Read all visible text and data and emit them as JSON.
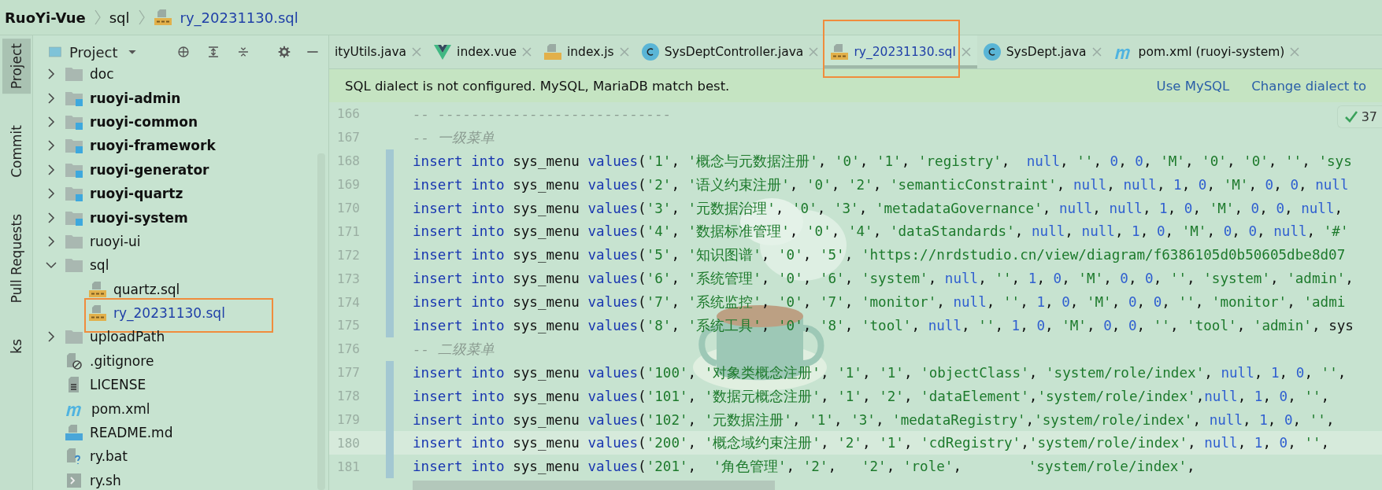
{
  "breadcrumb": [
    {
      "label": "RuoYi-Vue",
      "kind": "project"
    },
    {
      "label": "sql",
      "kind": "folder"
    },
    {
      "label": "ry_20231130.sql",
      "kind": "sql"
    }
  ],
  "tool_stripe": [
    {
      "label": "Project",
      "selected": true
    },
    {
      "label": "Commit",
      "selected": false
    },
    {
      "label": "Pull Requests",
      "selected": false
    },
    {
      "label": "ks",
      "selected": false
    }
  ],
  "project_panel": {
    "title": "Project",
    "tree": [
      {
        "label": "doc",
        "kind": "folder",
        "expanded": false
      },
      {
        "label": "ruoyi-admin",
        "kind": "module",
        "expanded": false
      },
      {
        "label": "ruoyi-common",
        "kind": "module",
        "expanded": false
      },
      {
        "label": "ruoyi-framework",
        "kind": "module",
        "expanded": false
      },
      {
        "label": "ruoyi-generator",
        "kind": "module",
        "expanded": false
      },
      {
        "label": "ruoyi-quartz",
        "kind": "module",
        "expanded": false
      },
      {
        "label": "ruoyi-system",
        "kind": "module",
        "expanded": false
      },
      {
        "label": "ruoyi-ui",
        "kind": "folder",
        "expanded": false
      },
      {
        "label": "sql",
        "kind": "folder",
        "expanded": true,
        "children": [
          {
            "label": "quartz.sql",
            "kind": "sql",
            "modified": false,
            "highlighted": false
          },
          {
            "label": "ry_20231130.sql",
            "kind": "sql",
            "modified": true,
            "highlighted": true
          }
        ]
      },
      {
        "label": "uploadPath",
        "kind": "folder",
        "expanded": false
      },
      {
        "label": ".gitignore",
        "kind": "ignore"
      },
      {
        "label": "LICENSE",
        "kind": "text"
      },
      {
        "label": "pom.xml",
        "kind": "maven"
      },
      {
        "label": "README.md",
        "kind": "markdown"
      },
      {
        "label": "ry.bat",
        "kind": "unknown"
      },
      {
        "label": "ry.sh",
        "kind": "shell"
      }
    ]
  },
  "tabs": [
    {
      "label": "ityUtils.java",
      "kind": "none",
      "selected": false,
      "modified": false,
      "highlighted": false
    },
    {
      "label": "index.vue",
      "kind": "vue",
      "selected": false,
      "modified": false,
      "highlighted": false
    },
    {
      "label": "index.js",
      "kind": "js",
      "selected": false,
      "modified": false,
      "highlighted": false
    },
    {
      "label": "SysDeptController.java",
      "kind": "class",
      "selected": false,
      "modified": false,
      "highlighted": false
    },
    {
      "label": "ry_20231130.sql",
      "kind": "sql",
      "selected": true,
      "modified": true,
      "highlighted": true
    },
    {
      "label": "SysDept.java",
      "kind": "class",
      "selected": false,
      "modified": false,
      "highlighted": false
    },
    {
      "label": "pom.xml (ruoyi-system)",
      "kind": "maven",
      "selected": false,
      "modified": false,
      "highlighted": false
    }
  ],
  "banner": {
    "message": "SQL dialect is not configured. MySQL, MariaDB match best.",
    "actions": [
      "Use MySQL",
      "Change dialect to"
    ]
  },
  "inspection_badge": "37",
  "code_lines": [
    {
      "number": "166",
      "text": "-- ----------------------------",
      "changed": false,
      "current": false
    },
    {
      "number": "167",
      "text": "-- 一级菜单",
      "changed": false,
      "current": false
    },
    {
      "number": "168",
      "text": "insert into sys_menu values('1', '概念与元数据注册', '0', '1', 'registry',  null, '', 0, 0, 'M', '0', '0', '', 'sys",
      "changed": true,
      "current": false
    },
    {
      "number": "169",
      "text": "insert into sys_menu values('2', '语义约束注册', '0', '2', 'semanticConstraint', null, null, 1, 0, 'M', 0, 0, null",
      "changed": true,
      "current": false
    },
    {
      "number": "170",
      "text": "insert into sys_menu values('3', '元数据治理', '0', '3', 'metadataGovernance', null, null, 1, 0, 'M', 0, 0, null,",
      "changed": true,
      "current": false
    },
    {
      "number": "171",
      "text": "insert into sys_menu values('4', '数据标准管理', '0', '4', 'dataStandards', null, null, 1, 0, 'M', 0, 0, null, '#'",
      "changed": true,
      "current": false
    },
    {
      "number": "172",
      "text": "insert into sys_menu values('5', '知识图谱', '0', '5', 'https://nrdstudio.cn/view/diagram/f6386105d0b50605dbe8d07",
      "changed": true,
      "current": false
    },
    {
      "number": "173",
      "text": "insert into sys_menu values('6', '系统管理', '0', '6', 'system', null, '', 1, 0, 'M', 0, 0, '', 'system', 'admin',",
      "changed": true,
      "current": false
    },
    {
      "number": "174",
      "text": "insert into sys_menu values('7', '系统监控', '0', '7', 'monitor', null, '', 1, 0, 'M', 0, 0, '', 'monitor', 'admi",
      "changed": true,
      "current": false
    },
    {
      "number": "175",
      "text": "insert into sys_menu values('8', '系统工具', '0', '8', 'tool', null, '', 1, 0, 'M', 0, 0, '', 'tool', 'admin', sys",
      "changed": true,
      "current": false
    },
    {
      "number": "176",
      "text": "-- 二级菜单",
      "changed": false,
      "current": false
    },
    {
      "number": "177",
      "text": "insert into sys_menu values('100', '对象类概念注册', '1', '1', 'objectClass', 'system/role/index', null, 1, 0, '',",
      "changed": true,
      "current": false
    },
    {
      "number": "178",
      "text": "insert into sys_menu values('101', '数据元概念注册', '1', '2', 'dataElement','system/role/index',null, 1, 0, '',",
      "changed": true,
      "current": false
    },
    {
      "number": "179",
      "text": "insert into sys_menu values('102', '元数据注册', '1', '3', 'medataRegistry','system/role/index', null, 1, 0, '',",
      "changed": true,
      "current": false
    },
    {
      "number": "180",
      "text": "insert into sys_menu values('200', '概念域约束注册', '2', '1', 'cdRegistry','system/role/index', null, 1, 0, '',",
      "changed": true,
      "current": true
    },
    {
      "number": "181",
      "text": "insert into sys_menu values('201',  '角色管理', '2',   '2', 'role',        'system/role/index',",
      "changed": true,
      "current": false
    }
  ]
}
